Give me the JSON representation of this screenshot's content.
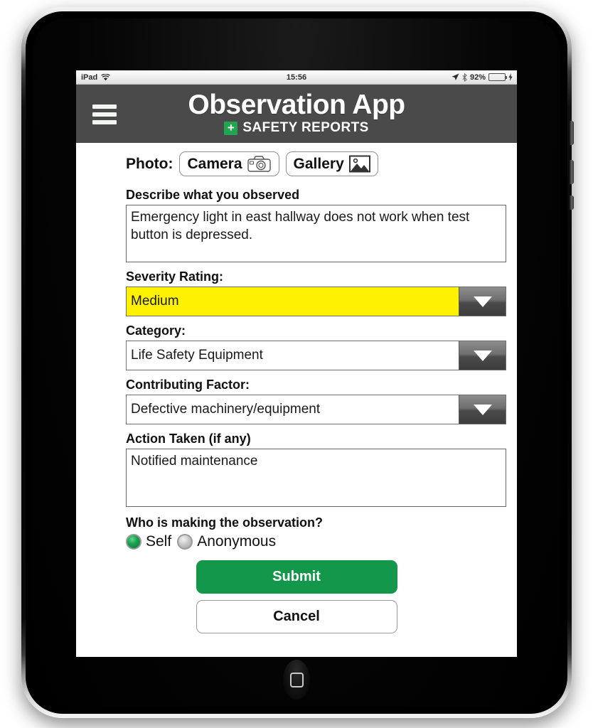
{
  "device": {
    "name": "ipad",
    "home_button_icon": "rounded-square-icon"
  },
  "status_bar": {
    "carrier": "iPad",
    "wifi_icon": "wifi-icon",
    "time": "15:56",
    "location_icon": "location-arrow-icon",
    "bluetooth_icon": "bluetooth-icon",
    "battery_percent": "92%",
    "battery_level": 92,
    "battery_icon": "battery-icon",
    "charging_icon": "charging-bolt-icon"
  },
  "header": {
    "menu_icon": "hamburger-menu-icon",
    "title": "Observation App",
    "brand_plus_icon": "plus-icon",
    "brand_name": "SAFETY REPORTS",
    "background_color": "#4a4a4a",
    "brand_accent_color": "#21a551"
  },
  "form": {
    "photo": {
      "label": "Photo:",
      "camera_button": "Camera",
      "camera_icon": "camera-icon",
      "gallery_button": "Gallery",
      "gallery_icon": "image-gallery-icon"
    },
    "describe": {
      "label": "Describe what you observed",
      "value": "Emergency light in east hallway does not work when test button is depressed."
    },
    "severity": {
      "label": "Severity Rating:",
      "value": "Medium",
      "highlight_color": "#fff200",
      "dropdown_icon": "chevron-down-icon"
    },
    "category": {
      "label": "Category:",
      "value": "Life Safety Equipment",
      "dropdown_icon": "chevron-down-icon"
    },
    "contributing_factor": {
      "label": "Contributing Factor:",
      "value": "Defective machinery/equipment",
      "dropdown_icon": "chevron-down-icon"
    },
    "action_taken": {
      "label": "Action Taken (if any)",
      "value": "Notified maintenance"
    },
    "observer": {
      "label": "Who is making the observation?",
      "options": [
        {
          "label": "Self",
          "selected": true
        },
        {
          "label": "Anonymous",
          "selected": false
        }
      ]
    },
    "submit_label": "Submit",
    "cancel_label": "Cancel",
    "submit_color": "#13974a"
  }
}
